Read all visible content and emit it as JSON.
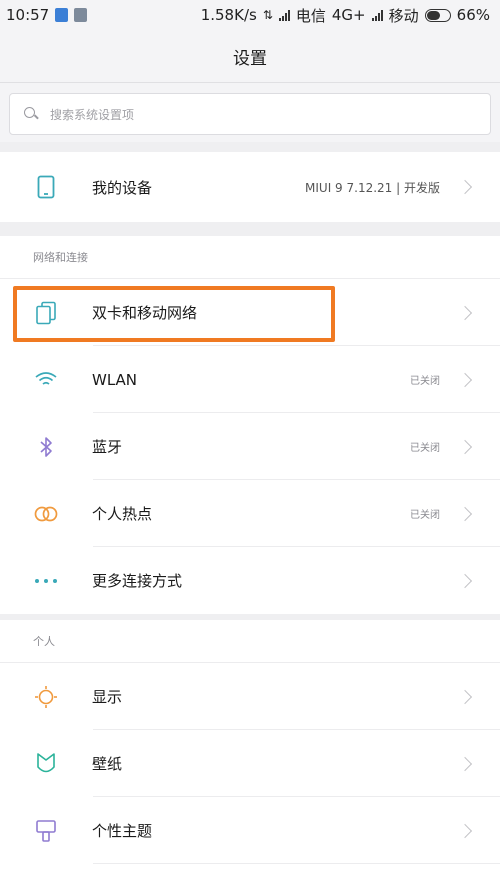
{
  "status_bar": {
    "time": "10:57",
    "speed": "1.58K/s",
    "carrier1": "电信",
    "network": "4G+",
    "carrier2": "移动",
    "battery": "66%"
  },
  "title": "设置",
  "search": {
    "placeholder": "搜索系统设置项"
  },
  "device": {
    "label": "我的设备",
    "value": "MIUI 9 7.12.21 | 开发版"
  },
  "network_section": {
    "title": "网络和连接",
    "items": [
      {
        "label": "双卡和移动网络",
        "value": "",
        "icon": "sim-card-icon"
      },
      {
        "label": "WLAN",
        "value": "已关闭",
        "icon": "wifi-icon"
      },
      {
        "label": "蓝牙",
        "value": "已关闭",
        "icon": "bluetooth-icon"
      },
      {
        "label": "个人热点",
        "value": "已关闭",
        "icon": "hotspot-icon"
      },
      {
        "label": "更多连接方式",
        "value": "",
        "icon": "more-dots-icon"
      }
    ]
  },
  "personal_section": {
    "title": "个人",
    "items": [
      {
        "label": "显示",
        "icon": "display-sun-icon"
      },
      {
        "label": "壁纸",
        "icon": "wallpaper-icon"
      },
      {
        "label": "个性主题",
        "icon": "theme-brush-icon"
      }
    ]
  },
  "colors": {
    "highlight": "#f07a22",
    "accent_teal": "#3aa9b8"
  }
}
